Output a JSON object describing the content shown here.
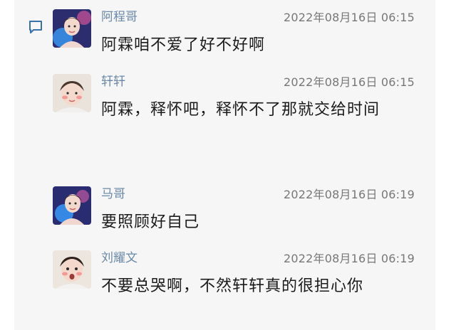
{
  "comments": [
    {
      "user": "阿程哥",
      "time": "2022年08月16日 06:15",
      "text": "阿霖咱不爱了好不好啊",
      "avatar": "avatar-boy-blue-glow"
    },
    {
      "user": "轩轩",
      "time": "2022年08月16日 06:15",
      "text": "阿霖，释怀吧，释怀不了那就交给时间",
      "avatar": "avatar-boy-blush"
    },
    {
      "user": "马哥",
      "time": "2022年08月16日 06:19",
      "text": "要照顾好自己",
      "avatar": "avatar-boy-blue-glow"
    },
    {
      "user": "刘耀文",
      "time": "2022年08月16日 06:19",
      "text": "不要总哭啊，不然轩轩真的很担心你",
      "avatar": "avatar-boy-surprised"
    }
  ],
  "icons": {
    "comment": "comment-icon"
  },
  "colors": {
    "username": "#6a88a8",
    "timestamp": "#777777",
    "text": "#1b1b1b",
    "panel": "#f6f6f6",
    "icon": "#3a6fb0"
  }
}
